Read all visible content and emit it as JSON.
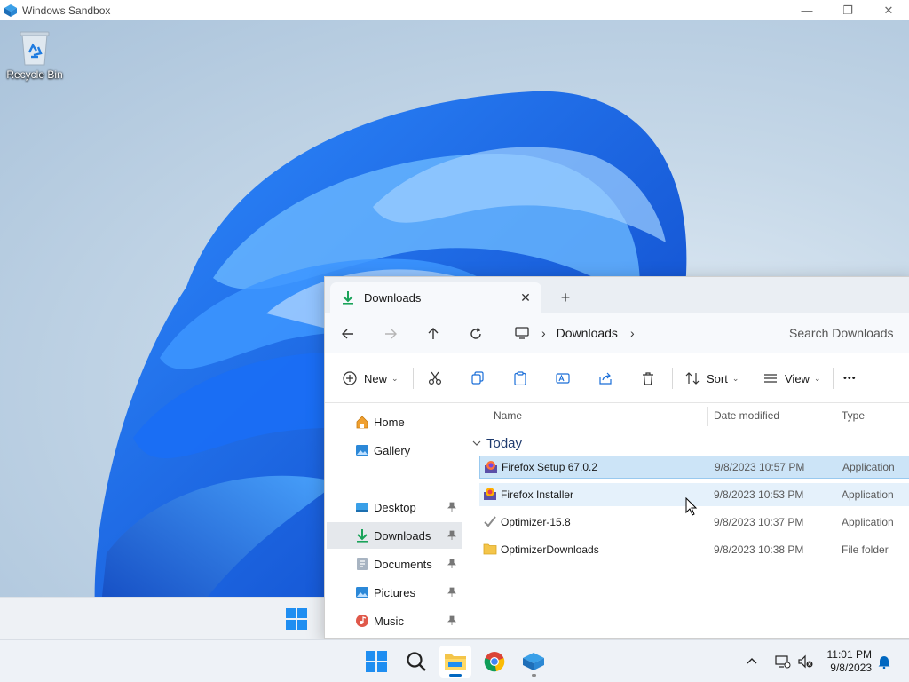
{
  "sandbox_window": {
    "title": "Windows Sandbox",
    "controls": {
      "minimize": "—",
      "maximize": "❐",
      "close": "✕"
    }
  },
  "desktop": {
    "icons": [
      {
        "label": "Recycle Bin",
        "icon": "recycle-bin-icon"
      }
    ]
  },
  "explorer": {
    "tab": {
      "label": "Downloads",
      "close": "✕",
      "add": "+"
    },
    "address": {
      "location": "Downloads",
      "separator": "›",
      "trailing": "›"
    },
    "search_placeholder": "Search Downloads",
    "toolbar": {
      "new": "New",
      "sort": "Sort",
      "view": "View",
      "more": "•••"
    },
    "nav": [
      {
        "label": "Home",
        "icon": "home-icon",
        "pinned": false
      },
      {
        "label": "Gallery",
        "icon": "gallery-icon",
        "pinned": false
      },
      {
        "label": "Desktop",
        "icon": "desktop-folder-icon",
        "pinned": true
      },
      {
        "label": "Downloads",
        "icon": "download-icon",
        "pinned": true,
        "selected": true
      },
      {
        "label": "Documents",
        "icon": "documents-icon",
        "pinned": true
      },
      {
        "label": "Pictures",
        "icon": "pictures-icon",
        "pinned": true
      },
      {
        "label": "Music",
        "icon": "music-icon",
        "pinned": true
      }
    ],
    "columns": {
      "name": "Name",
      "date": "Date modified",
      "type": "Type"
    },
    "group": "Today",
    "files": [
      {
        "name": "Firefox Setup 67.0.2",
        "date": "9/8/2023 10:57 PM",
        "type": "Application",
        "icon": "firefox-setup-icon",
        "state": "selected"
      },
      {
        "name": "Firefox Installer",
        "date": "9/8/2023 10:53 PM",
        "type": "Application",
        "icon": "firefox-installer-icon",
        "state": "hover"
      },
      {
        "name": "Optimizer-15.8",
        "date": "9/8/2023 10:37 PM",
        "type": "Application",
        "icon": "checkmark-app-icon",
        "state": "normal"
      },
      {
        "name": "OptimizerDownloads",
        "date": "9/8/2023 10:38 PM",
        "type": "File folder",
        "icon": "folder-icon",
        "state": "normal"
      }
    ]
  },
  "taskbar": {
    "apps": [
      "start-icon",
      "search-icon",
      "file-explorer-icon",
      "chrome-icon",
      "sandbox-icon"
    ],
    "clock": {
      "time": "11:01 PM",
      "date": "9/8/2023"
    }
  },
  "colors": {
    "accent": "#0067c0",
    "selection": "#cce4f7",
    "window_blue": "#1a73e8"
  }
}
